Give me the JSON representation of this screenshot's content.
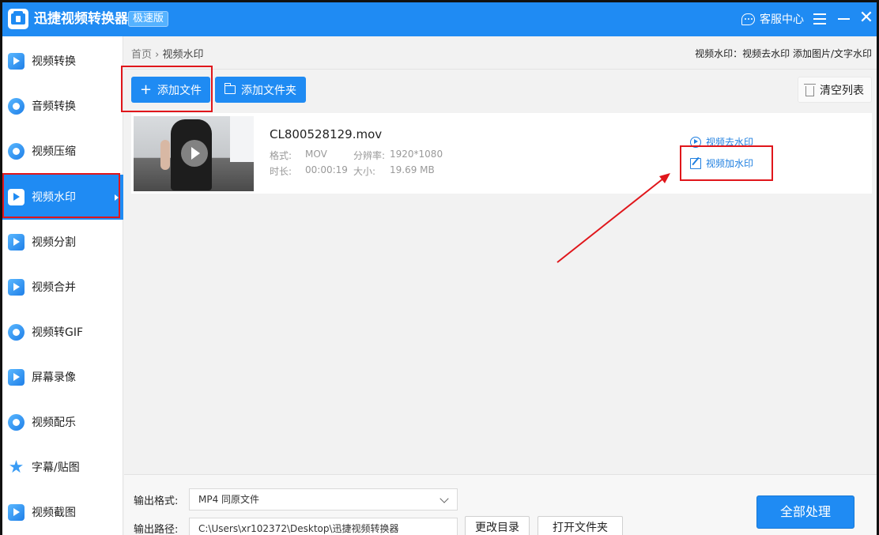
{
  "app": {
    "title": "迅捷视频转换器",
    "badge": "极速版",
    "support": "客服中心"
  },
  "sidebar": {
    "items": [
      {
        "label": "视频转换",
        "icon": "video-convert-icon"
      },
      {
        "label": "音频转换",
        "icon": "audio-convert-icon"
      },
      {
        "label": "视频压缩",
        "icon": "video-compress-icon"
      },
      {
        "label": "视频水印",
        "icon": "video-watermark-icon",
        "active": true
      },
      {
        "label": "视频分割",
        "icon": "video-split-icon"
      },
      {
        "label": "视频合并",
        "icon": "video-merge-icon"
      },
      {
        "label": "视频转GIF",
        "icon": "video-gif-icon"
      },
      {
        "label": "屏幕录像",
        "icon": "screen-record-icon"
      },
      {
        "label": "视频配乐",
        "icon": "video-music-icon"
      },
      {
        "label": "字幕/贴图",
        "icon": "subtitle-sticker-icon"
      },
      {
        "label": "视频截图",
        "icon": "video-screenshot-icon"
      }
    ]
  },
  "breadcrumb": {
    "home": "首页",
    "sep": "›",
    "current": "视频水印"
  },
  "top_links": "视频水印：视频去水印 添加图片/文字水印",
  "toolbar": {
    "add_file": "添加文件",
    "add_folder": "添加文件夹",
    "clear_list": "清空列表"
  },
  "file": {
    "name": "CL800528129.mov",
    "format_label": "格式:",
    "format_value": "MOV",
    "resolution_label": "分辨率:",
    "resolution_value": "1920*1080",
    "duration_label": "时长:",
    "duration_value": "00:00:19",
    "size_label": "大小:",
    "size_value": "19.69 MB",
    "action_remove": "视频去水印",
    "action_add": "视频加水印"
  },
  "bottom": {
    "format_label": "输出格式:",
    "format_value": "MP4  同原文件",
    "path_label": "输出路径:",
    "path_value": "C:\\Users\\xr102372\\Desktop\\迅捷视频转换器",
    "change_dir": "更改目录",
    "open_folder": "打开文件夹",
    "process_all": "全部处理"
  },
  "colors": {
    "accent": "#1f8bf3",
    "annotation": "#e0161b"
  }
}
